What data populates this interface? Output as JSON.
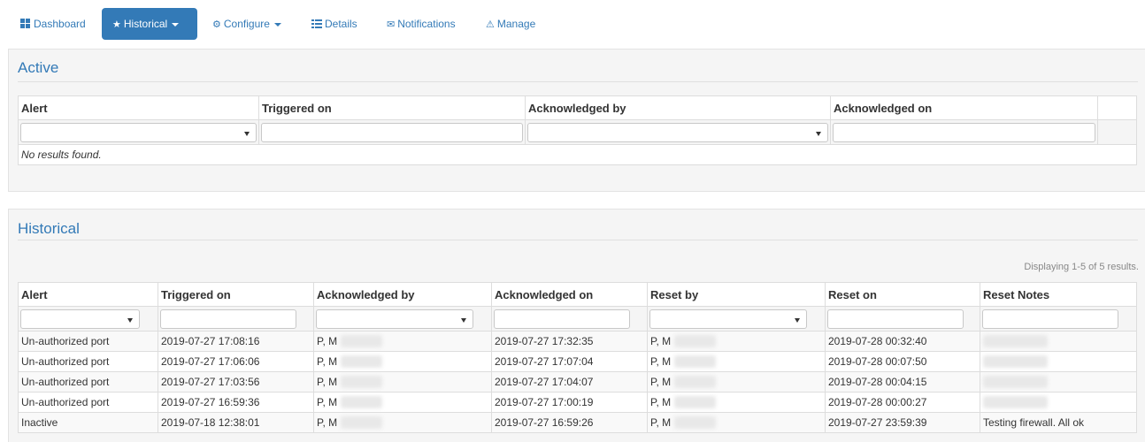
{
  "nav": {
    "items": [
      {
        "label": "Dashboard",
        "icon": "dashboard-icon"
      },
      {
        "label": "Historical",
        "icon": "star-icon"
      },
      {
        "label": "Configure",
        "icon": "gear-icon"
      },
      {
        "label": "Details",
        "icon": "list-icon"
      },
      {
        "label": "Notifications",
        "icon": "envelope-icon"
      },
      {
        "label": "Manage",
        "icon": "warning-icon"
      }
    ],
    "active": "Historical",
    "accent_color": "#337ab7"
  },
  "active_panel": {
    "title": "Active",
    "columns": [
      "Alert",
      "Triggered on",
      "Acknowledged by",
      "Acknowledged on"
    ],
    "empty_message": "No results found."
  },
  "historical_panel": {
    "title": "Historical",
    "count_text": "Displaying 1-5 of 5 results.",
    "columns": [
      "Alert",
      "Triggered on",
      "Acknowledged by",
      "Acknowledged on",
      "Reset by",
      "Reset on",
      "Reset Notes"
    ],
    "rows": [
      {
        "alert": "Un-authorized port",
        "triggered": "2019-07-27 17:08:16",
        "ack_by": "P, M",
        "ack_on": "2019-07-27 17:32:35",
        "reset_by": "P, M",
        "reset_on": "2019-07-28 00:32:40",
        "notes": ""
      },
      {
        "alert": "Un-authorized port",
        "triggered": "2019-07-27 17:06:06",
        "ack_by": "P, M",
        "ack_on": "2019-07-27 17:07:04",
        "reset_by": "P, M",
        "reset_on": "2019-07-28 00:07:50",
        "notes": ""
      },
      {
        "alert": "Un-authorized port",
        "triggered": "2019-07-27 17:03:56",
        "ack_by": "P, M",
        "ack_on": "2019-07-27 17:04:07",
        "reset_by": "P, M",
        "reset_on": "2019-07-28 00:04:15",
        "notes": ""
      },
      {
        "alert": "Un-authorized port",
        "triggered": "2019-07-27 16:59:36",
        "ack_by": "P, M",
        "ack_on": "2019-07-27 17:00:19",
        "reset_by": "P, M",
        "reset_on": "2019-07-28 00:00:27",
        "notes": ""
      },
      {
        "alert": "Inactive",
        "triggered": "2019-07-18 12:38:01",
        "ack_by": "P, M",
        "ack_on": "2019-07-27 16:59:26",
        "reset_by": "P, M",
        "reset_on": "2019-07-27 23:59:39",
        "notes": "Testing firewall. All ok"
      }
    ]
  }
}
